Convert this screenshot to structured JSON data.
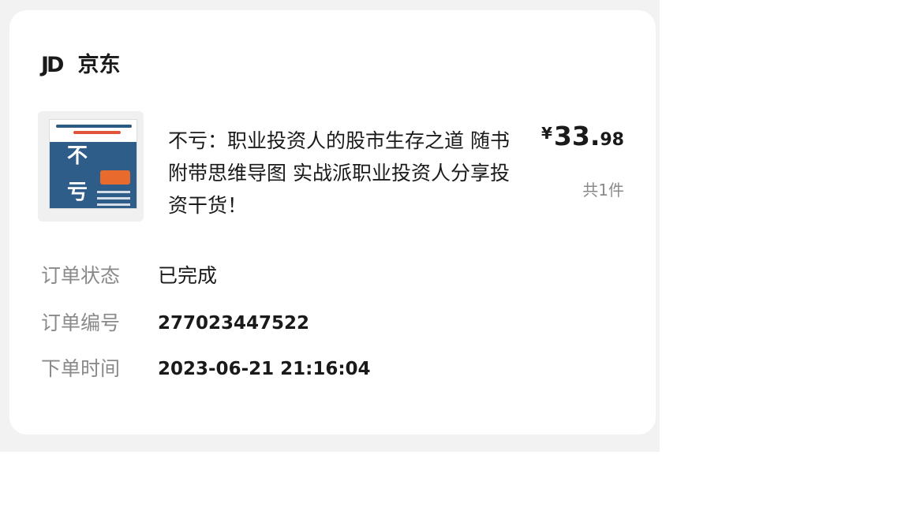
{
  "store": {
    "logo_text": "JD",
    "name": "京东"
  },
  "product": {
    "title": "不亏：职业投资人的股市生存之道 随书附带思维导图 实战派职业投资人分享投资干货！",
    "cover_char_1": "不",
    "cover_char_2": "亏",
    "price_currency": "¥",
    "price_integer": "33.",
    "price_decimal": "98",
    "quantity": "共1件"
  },
  "order": {
    "status_label": "订单状态",
    "status_value": "已完成",
    "number_label": "订单编号",
    "number_value": "277023447522",
    "time_label": "下单时间",
    "time_value": "2023-06-21 21:16:04"
  },
  "colors": {
    "background": "#f2f2f2",
    "card": "#ffffff",
    "text_primary": "#1a1a1a",
    "text_secondary": "#8a8a8a",
    "book_blue": "#2f5d8a",
    "book_orange": "#e86a2c"
  }
}
